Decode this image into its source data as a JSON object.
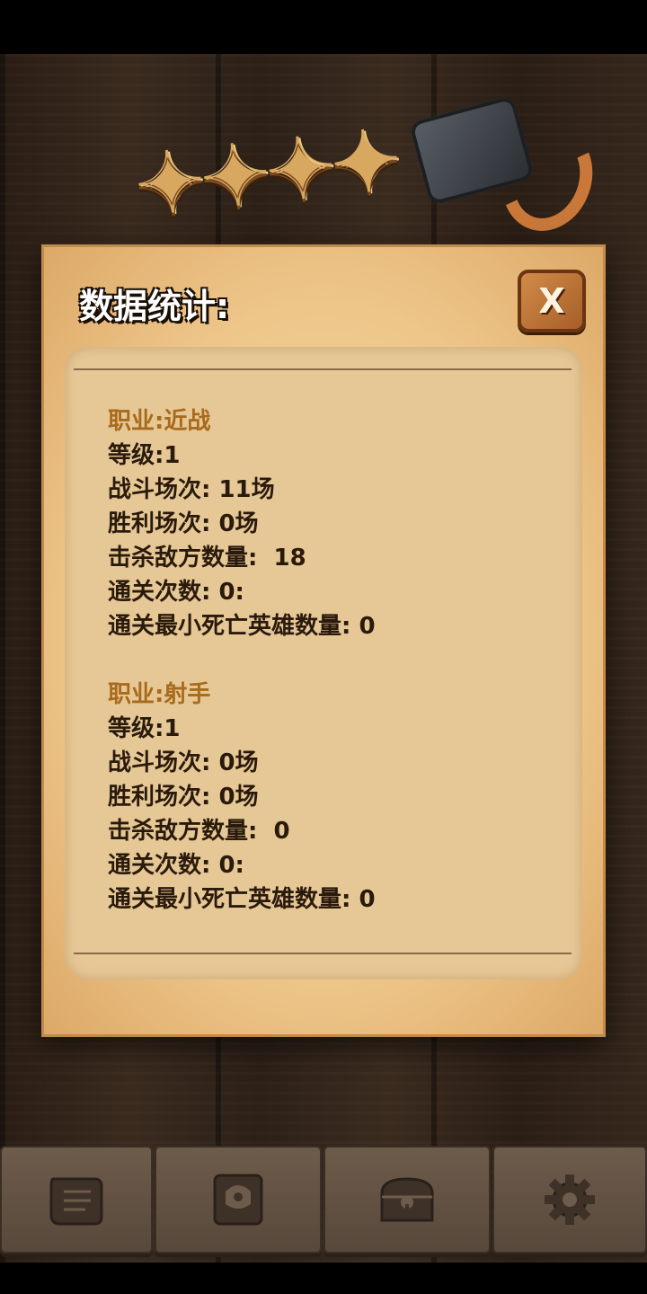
{
  "dialog": {
    "title": "数据统计:",
    "close_label": "X"
  },
  "classes": [
    {
      "title": "职业:近战",
      "stats": [
        "等级:1",
        "战斗场次: 11场",
        "胜利场次: 0场",
        "击杀敌方数量:  18",
        "通关次数: 0:",
        "通关最小死亡英雄数量: 0"
      ]
    },
    {
      "title": "职业:射手",
      "stats": [
        "等级:1",
        "战斗场次: 0场",
        "胜利场次: 0场",
        "击杀敌方数量:  0",
        "通关次数: 0:",
        "通关最小死亡英雄数量: 0"
      ]
    }
  ],
  "bottom_nav": [
    {
      "icon": "scroll-icon"
    },
    {
      "icon": "helmet-badge-icon"
    },
    {
      "icon": "treasure-chest-icon"
    },
    {
      "icon": "gear-icon"
    }
  ],
  "colors": {
    "parchment": "#eec68a",
    "class_title": "#a86a1c",
    "stat_text": "#2a1a0c",
    "close_button": "#c47838"
  }
}
